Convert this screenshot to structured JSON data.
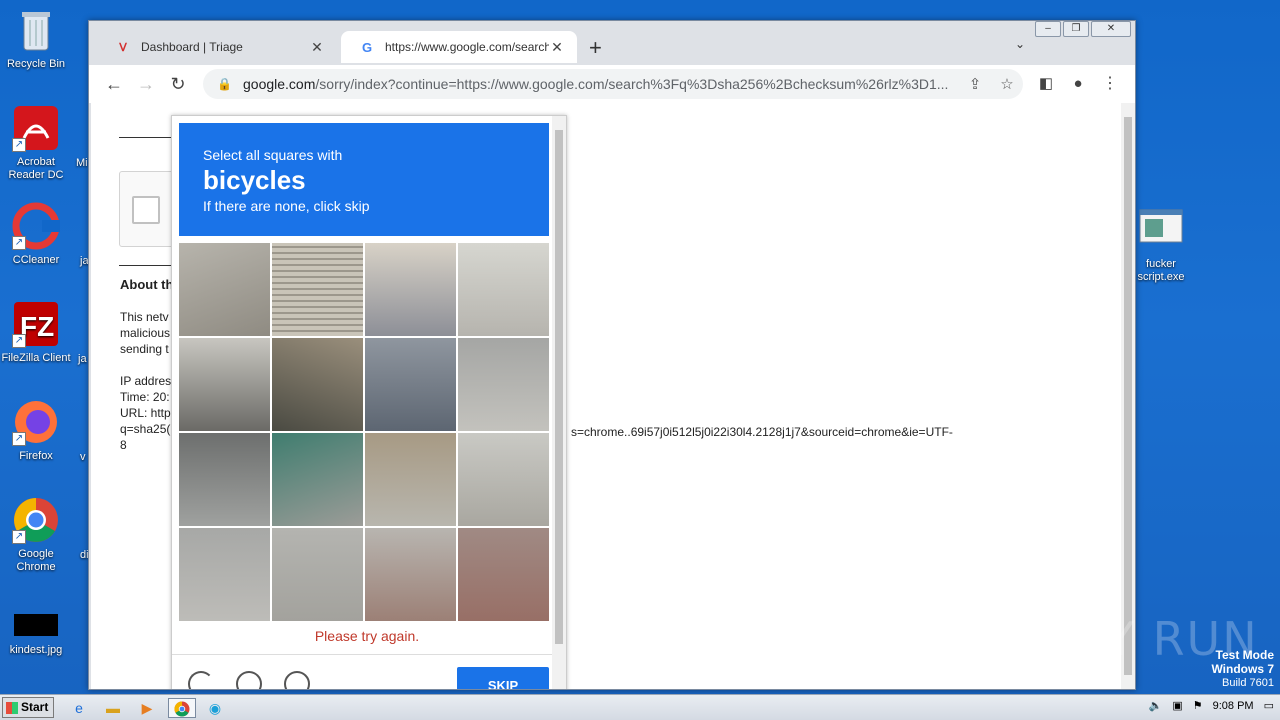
{
  "desktop": {
    "icons": [
      {
        "label": "Recycle Bin",
        "icon": "recycle-bin-icon"
      },
      {
        "label": "Acrobat Reader DC",
        "icon": "acrobat-icon"
      },
      {
        "label": "CCleaner",
        "icon": "ccleaner-icon"
      },
      {
        "label": "FileZilla Client",
        "icon": "filezilla-icon"
      },
      {
        "label": "Firefox",
        "icon": "firefox-icon"
      },
      {
        "label": "Google Chrome",
        "icon": "chrome-icon"
      },
      {
        "label": "kindest.jpg",
        "icon": "image-file-icon"
      },
      {
        "label": "fucker script.exe",
        "icon": "exe-file-icon"
      }
    ],
    "side_letters": [
      "Mi",
      "ja",
      "ja",
      "v",
      "di"
    ]
  },
  "browser": {
    "tabs": [
      {
        "title": "Dashboard | Triage",
        "close": "✕"
      },
      {
        "title": "https://www.google.com/search?q=",
        "close": "✕"
      }
    ],
    "new_tab": "+",
    "tab_list": "⌄",
    "window_controls": [
      "–",
      "❐",
      "✕"
    ],
    "nav": {
      "back": "←",
      "forward": "→",
      "reload": "↻"
    },
    "omnibox": {
      "domain": "google.com",
      "path": "/sorry/index?continue=https://www.google.com/search%3Fq%3Dsha256%2Bchecksum%26rlz%3D1..."
    }
  },
  "page": {
    "about_heading": "About th",
    "para_lines": [
      "This netv",
      "malicious",
      "sending t"
    ],
    "info_lines": [
      "IP addres",
      "Time: 20:",
      "URL: http",
      "q=sha25(",
      "8"
    ],
    "url_continuation": "s=chrome..69i57j0i512l5j0i22i30l4.2128j1j7&sourceid=chrome&ie=UTF-"
  },
  "captcha": {
    "instruction": "Select all squares with",
    "target": "bicycles",
    "hint": "If there are none, click skip",
    "error": "Please try again.",
    "skip_label": "SKIP"
  },
  "watermark": "ANY RUN",
  "system": {
    "test_mode": "Test Mode",
    "os": "Windows 7",
    "build": "Build 7601",
    "start_label": "Start",
    "clock": "9:08 PM"
  }
}
